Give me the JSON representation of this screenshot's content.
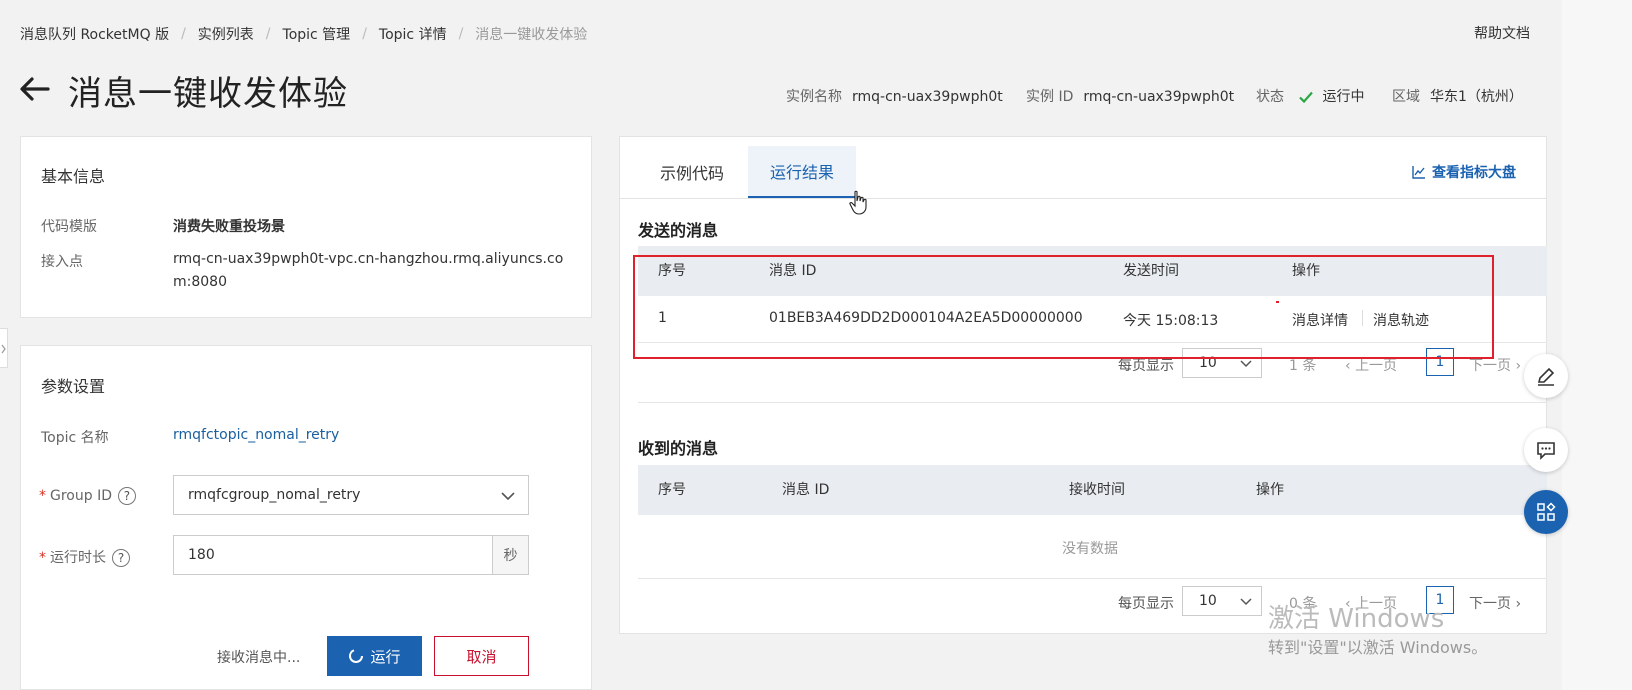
{
  "breadcrumb": [
    {
      "label": "消息队列 RocketMQ 版"
    },
    {
      "label": "实例列表"
    },
    {
      "label": "Topic 管理"
    },
    {
      "label": "Topic 详情"
    },
    {
      "label": "消息一键收发体验"
    }
  ],
  "header": {
    "help": "帮助文档",
    "title": "消息一键收发体验",
    "instance_name_label": "实例名称",
    "instance_name": "rmq-cn-uax39pwph0t",
    "instance_id_label": "实例 ID",
    "instance_id": "rmq-cn-uax39pwph0t",
    "status_label": "状态",
    "status": "运行中",
    "region_label": "区域",
    "region": "华东1（杭州）"
  },
  "basic_info": {
    "title": "基本信息",
    "template_label": "代码模版",
    "template": "消费失败重投场景",
    "endpoint_label": "接入点",
    "endpoint_line1": "rmq-cn-uax39pwph0t-vpc.cn-hangzhou.rmq.aliyuncs.co",
    "endpoint_line2": "m:8080"
  },
  "params": {
    "title": "参数设置",
    "topic_label": "Topic 名称",
    "topic": "rmqfctopic_nomal_retry",
    "required_mark": "*",
    "group_label": "Group ID",
    "group": "rmqfcgroup_nomal_retry",
    "duration_label": "运行时长",
    "duration": "180",
    "duration_unit": "秒",
    "help_glyph": "?",
    "receiving": "接收消息中...",
    "run_button": "运行",
    "cancel_button": "取消"
  },
  "tabs": [
    {
      "label": "示例代码",
      "active": false
    },
    {
      "label": "运行结果",
      "active": true
    }
  ],
  "metrics_link": "查看指标大盘",
  "sent": {
    "title": "发送的消息",
    "headers": [
      "序号",
      "消息 ID",
      "发送时间",
      "操作"
    ],
    "rows": [
      {
        "no": "1",
        "id": "01BEB3A469DD2D000104A2EA5D00000000",
        "time": "今天 15:08:13",
        "action1": "消息详情",
        "action2": "消息轨迹"
      }
    ],
    "pager": {
      "per_page_label": "每页显示",
      "per_page": "10",
      "total": "1 条",
      "prev": "上一页",
      "page": "1",
      "next": "下一页"
    }
  },
  "received": {
    "title": "收到的消息",
    "headers": [
      "序号",
      "消息 ID",
      "接收时间",
      "操作"
    ],
    "empty": "没有数据",
    "pager": {
      "per_page_label": "每页显示",
      "per_page": "10",
      "total": "0 条",
      "prev": "上一页",
      "page": "1",
      "next": "下一页"
    }
  },
  "watermark": {
    "line1": "激活 Windows",
    "line2": "转到\"设置\"以激活 Windows。"
  },
  "colors": {
    "accent": "#1b62b0",
    "danger": "#c8102e",
    "success": "#2aa745",
    "highlight": "#e0202a"
  }
}
